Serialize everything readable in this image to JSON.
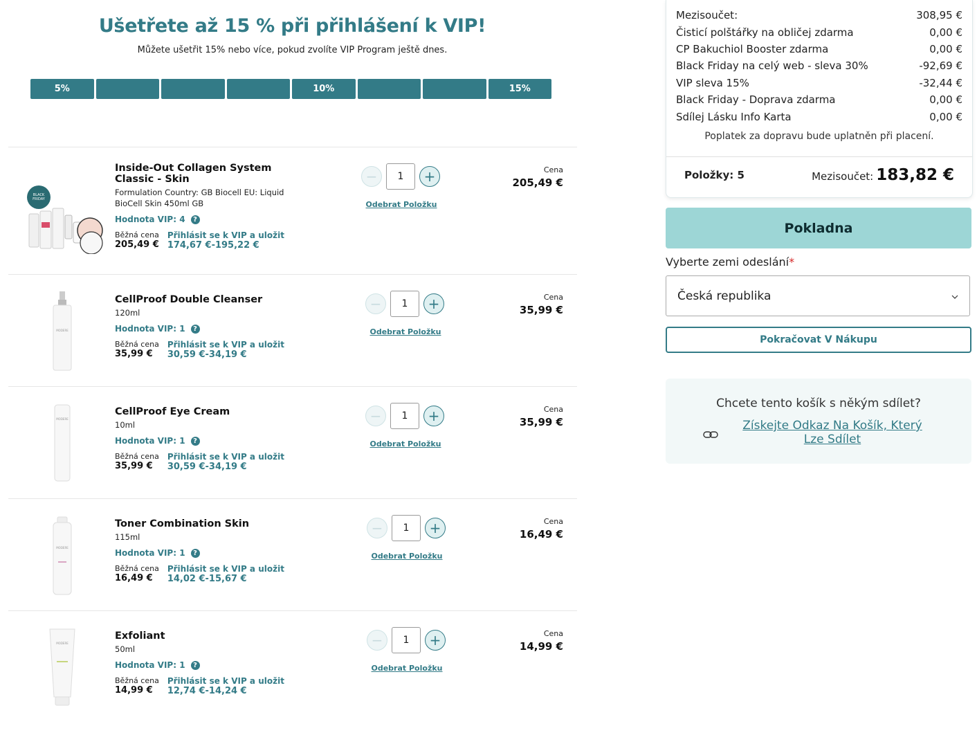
{
  "vip_banner": {
    "title": "Ušetřete až 15 % při přihlášení k VIP!",
    "subtitle": "Můžete ušetřit 15% nebo více, pokud zvolíte VIP Program ještě dnes.",
    "segments": [
      "5%",
      "",
      "",
      "",
      "10%",
      "",
      "",
      "15%"
    ],
    "accent_color": "#337b87"
  },
  "cart": {
    "remove_label": "Odebrat Položku",
    "price_label": "Cena",
    "regular_label": "Běžná cena",
    "vip_label": "Přihlásit se k VIP a uložit",
    "items": [
      {
        "name": "Inside-Out Collagen System Classic - Skin",
        "variant": "Formulation Country: GB Biocell EU: Liquid BioCell Skin 450ml GB",
        "vip_value": "Hodnota VIP: 4",
        "regular_price": "205,49 €",
        "vip_price": "174,67 €-195,22 €",
        "qty": "1",
        "price": "205,49 €"
      },
      {
        "name": "CellProof Double Cleanser",
        "variant": "120ml",
        "vip_value": "Hodnota VIP: 1",
        "regular_price": "35,99 €",
        "vip_price": "30,59 €-34,19 €",
        "qty": "1",
        "price": "35,99 €"
      },
      {
        "name": "CellProof Eye Cream",
        "variant": "10ml",
        "vip_value": "Hodnota VIP: 1",
        "regular_price": "35,99 €",
        "vip_price": "30,59 €-34,19 €",
        "qty": "1",
        "price": "35,99 €"
      },
      {
        "name": "Toner Combination Skin",
        "variant": "115ml",
        "vip_value": "Hodnota VIP: 1",
        "regular_price": "16,49 €",
        "vip_price": "14,02 €-15,67 €",
        "qty": "1",
        "price": "16,49 €"
      },
      {
        "name": "Exfoliant",
        "variant": "50ml",
        "vip_value": "Hodnota VIP: 1",
        "regular_price": "14,99 €",
        "vip_price": "12,74 €-14,24 €",
        "qty": "1",
        "price": "14,99 €"
      }
    ]
  },
  "summary": {
    "lines": [
      {
        "label": "Mezisoučet:",
        "value": "308,95 €"
      },
      {
        "label": "Čisticí polštářky na obličej zdarma",
        "value": "0,00 €"
      },
      {
        "label": "CP Bakuchiol Booster zdarma",
        "value": "0,00 €"
      },
      {
        "label": "Black Friday na celý web - sleva 30%",
        "value": "-92,69 €"
      },
      {
        "label": "VIP sleva 15%",
        "value": "-32,44 €"
      },
      {
        "label": "Black Friday - Doprava zdarma",
        "value": "0,00 €"
      },
      {
        "label": "Sdílej Lásku Info Karta",
        "value": "0,00 €"
      }
    ],
    "shipping_note": "Poplatek za dopravu bude uplatněn při placení.",
    "items_count": "Položky: 5",
    "subtotal_label": "Mezisoučet:",
    "subtotal_value": "183,82 €"
  },
  "checkout_label": "Pokladna",
  "country": {
    "label": "Vyberte zemi odeslání",
    "required_mark": "*",
    "selected": "Česká republika"
  },
  "continue_label": "Pokračovat V Nákupu",
  "share": {
    "question": "Chcete tento košík s někým sdílet?",
    "link": "Získejte Odkaz Na Košík, Který Lze Sdílet",
    "icon": "link-icon"
  }
}
